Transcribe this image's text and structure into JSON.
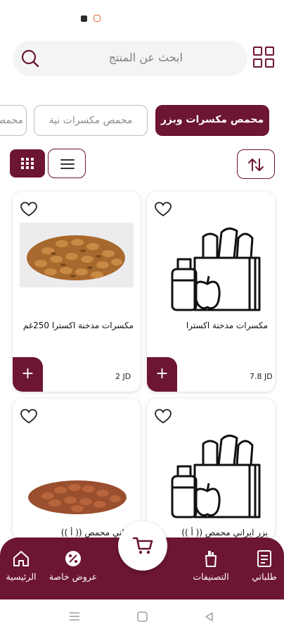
{
  "status_bar": {
    "notification_icons": [
      "app-icon",
      "gallery-icon"
    ]
  },
  "header": {
    "menu_icon": "grid-apps-icon"
  },
  "search": {
    "placeholder": "ابحث عن المنتج",
    "icon": "search-icon"
  },
  "categories": {
    "items": [
      {
        "label": "محمص مكسرات وبزر",
        "active": true
      },
      {
        "label": "محمص مكسرات نية",
        "active": false
      },
      {
        "label": "محمص مكسرات",
        "active": false
      }
    ]
  },
  "toolbar": {
    "sort_icon": "sort-arrows-icon",
    "grid_view_icon": "grid-view-icon",
    "list_view_icon": "list-view-icon"
  },
  "products": [
    {
      "name": "مكسرات مدخنة اكسترا",
      "price": "7.8 JD",
      "image": "grocery-placeholder",
      "add_label": "+"
    },
    {
      "name": "مكسرات مدخنة اكسترا 250غم",
      "price": "2 JD",
      "image": "smoked-nuts-photo",
      "add_label": "+"
    },
    {
      "name": "بزر ايراني محمص (( أ ))",
      "price": "",
      "image": "grocery-placeholder",
      "add_label": "+"
    },
    {
      "name": "ايراني محمص (( أ ))",
      "price": "",
      "image": "almonds-photo",
      "add_label": "+"
    }
  ],
  "bottom_nav": {
    "home": "الرئيسية",
    "offers": "عروض خاصة",
    "categories": "التصنيفات",
    "orders": "طلباتي"
  },
  "colors": {
    "brand": "#6d1535",
    "chip_border": "#bdbdbd",
    "search_bg": "#f4f4f4"
  }
}
